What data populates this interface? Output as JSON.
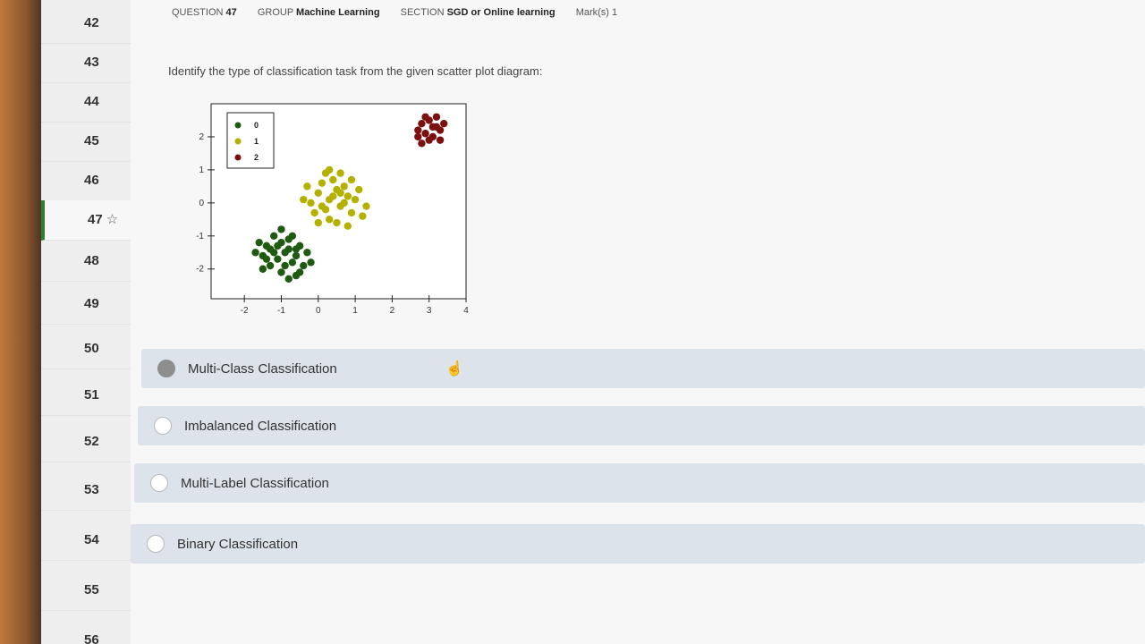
{
  "sidebar": {
    "items": [
      {
        "label": "42"
      },
      {
        "label": "43"
      },
      {
        "label": "44"
      },
      {
        "label": "45"
      },
      {
        "label": "46"
      },
      {
        "label": "47",
        "star": "☆"
      },
      {
        "label": "48"
      },
      {
        "label": "49"
      },
      {
        "label": "50"
      },
      {
        "label": "51"
      },
      {
        "label": "52"
      },
      {
        "label": "53"
      },
      {
        "label": "54"
      },
      {
        "label": "55"
      },
      {
        "label": "56"
      }
    ]
  },
  "header": {
    "question_label": "QUESTION",
    "question_number": "47",
    "group_label": "GROUP",
    "group_value": "Machine Learning",
    "section_label": "SECTION",
    "section_value": "SGD or Online learning",
    "marks_label": "Mark(s)",
    "marks_value": "1"
  },
  "question": {
    "text": "Identify the type of classification task from the given scatter plot diagram:"
  },
  "chart_data": {
    "type": "scatter",
    "xlim": [
      -2.9,
      4
    ],
    "ylim": [
      -2.9,
      3
    ],
    "xticks": [
      "-2",
      "-1",
      "0",
      "1",
      "2",
      "3",
      "4"
    ],
    "yticks": [
      "-2",
      "-1",
      "0",
      "1",
      "2"
    ],
    "legend_position": "top-left",
    "colors": {
      "0": "#1e5a10",
      "1": "#b4b000",
      "2": "#7a1010"
    },
    "series": [
      {
        "name": "0",
        "points": [
          [
            -1.5,
            -1.6
          ],
          [
            -1.4,
            -1.3
          ],
          [
            -1.2,
            -1.5
          ],
          [
            -1.0,
            -1.2
          ],
          [
            -0.8,
            -1.4
          ],
          [
            -0.6,
            -1.6
          ],
          [
            -1.3,
            -1.9
          ],
          [
            -1.1,
            -1.7
          ],
          [
            -0.9,
            -1.9
          ],
          [
            -0.7,
            -1.8
          ],
          [
            -0.5,
            -1.3
          ],
          [
            -1.6,
            -1.2
          ],
          [
            -1.0,
            -2.1
          ],
          [
            -0.4,
            -1.9
          ],
          [
            -1.2,
            -1.0
          ],
          [
            -0.8,
            -1.1
          ],
          [
            -0.6,
            -2.2
          ],
          [
            -1.4,
            -1.7
          ],
          [
            -0.3,
            -1.5
          ],
          [
            -1.7,
            -1.5
          ],
          [
            -0.9,
            -1.5
          ],
          [
            -1.1,
            -1.3
          ],
          [
            -0.7,
            -1.0
          ],
          [
            -0.5,
            -2.1
          ],
          [
            -1.5,
            -2.0
          ],
          [
            -0.2,
            -1.8
          ],
          [
            -1.0,
            -0.8
          ],
          [
            -0.8,
            -2.3
          ],
          [
            -1.3,
            -1.4
          ],
          [
            -0.6,
            -1.4
          ]
        ]
      },
      {
        "name": "1",
        "points": [
          [
            0.0,
            0.3
          ],
          [
            0.3,
            0.1
          ],
          [
            0.5,
            0.4
          ],
          [
            0.2,
            -0.2
          ],
          [
            0.6,
            -0.1
          ],
          [
            0.8,
            0.2
          ],
          [
            -0.2,
            0.0
          ],
          [
            0.4,
            0.7
          ],
          [
            0.1,
            0.6
          ],
          [
            0.7,
            0.5
          ],
          [
            0.9,
            -0.3
          ],
          [
            0.3,
            -0.5
          ],
          [
            -0.1,
            -0.3
          ],
          [
            1.0,
            0.1
          ],
          [
            0.5,
            -0.6
          ],
          [
            0.2,
            0.9
          ],
          [
            0.6,
            0.9
          ],
          [
            -0.3,
            0.5
          ],
          [
            1.2,
            -0.4
          ],
          [
            0.8,
            -0.7
          ],
          [
            0.0,
            -0.6
          ],
          [
            0.4,
            0.2
          ],
          [
            0.7,
            0.0
          ],
          [
            1.1,
            0.4
          ],
          [
            -0.4,
            0.1
          ],
          [
            0.3,
            1.0
          ],
          [
            0.9,
            0.7
          ],
          [
            0.1,
            -0.1
          ],
          [
            0.6,
            0.3
          ],
          [
            1.3,
            -0.1
          ]
        ]
      },
      {
        "name": "2",
        "points": [
          [
            2.8,
            2.4
          ],
          [
            3.0,
            2.5
          ],
          [
            3.2,
            2.3
          ],
          [
            2.9,
            2.1
          ],
          [
            3.1,
            2.0
          ],
          [
            3.3,
            2.2
          ],
          [
            2.7,
            2.2
          ],
          [
            3.0,
            1.9
          ],
          [
            2.8,
            1.8
          ],
          [
            3.2,
            2.6
          ],
          [
            3.4,
            2.4
          ],
          [
            2.9,
            2.6
          ],
          [
            3.1,
            2.3
          ],
          [
            2.7,
            2.0
          ],
          [
            3.3,
            1.9
          ]
        ]
      }
    ]
  },
  "options": [
    {
      "label": "Multi-Class Classification",
      "selected": true
    },
    {
      "label": "Imbalanced Classification",
      "selected": false
    },
    {
      "label": "Multi-Label Classification",
      "selected": false
    },
    {
      "label": "Binary Classification",
      "selected": false
    }
  ],
  "cursor_icon": "hand-pointer"
}
